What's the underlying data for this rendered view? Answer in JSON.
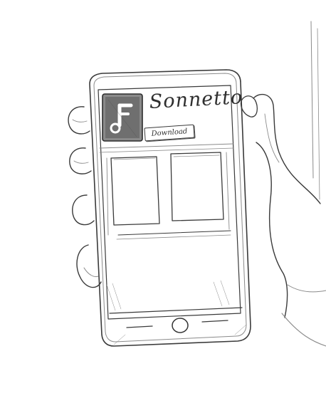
{
  "app": {
    "name": "Sonnetto",
    "download_label": "Download",
    "icon": "music-note-app-icon"
  },
  "content": {
    "cards": [
      "",
      ""
    ]
  },
  "device": {
    "home_button_icon": "home-button-icon"
  }
}
